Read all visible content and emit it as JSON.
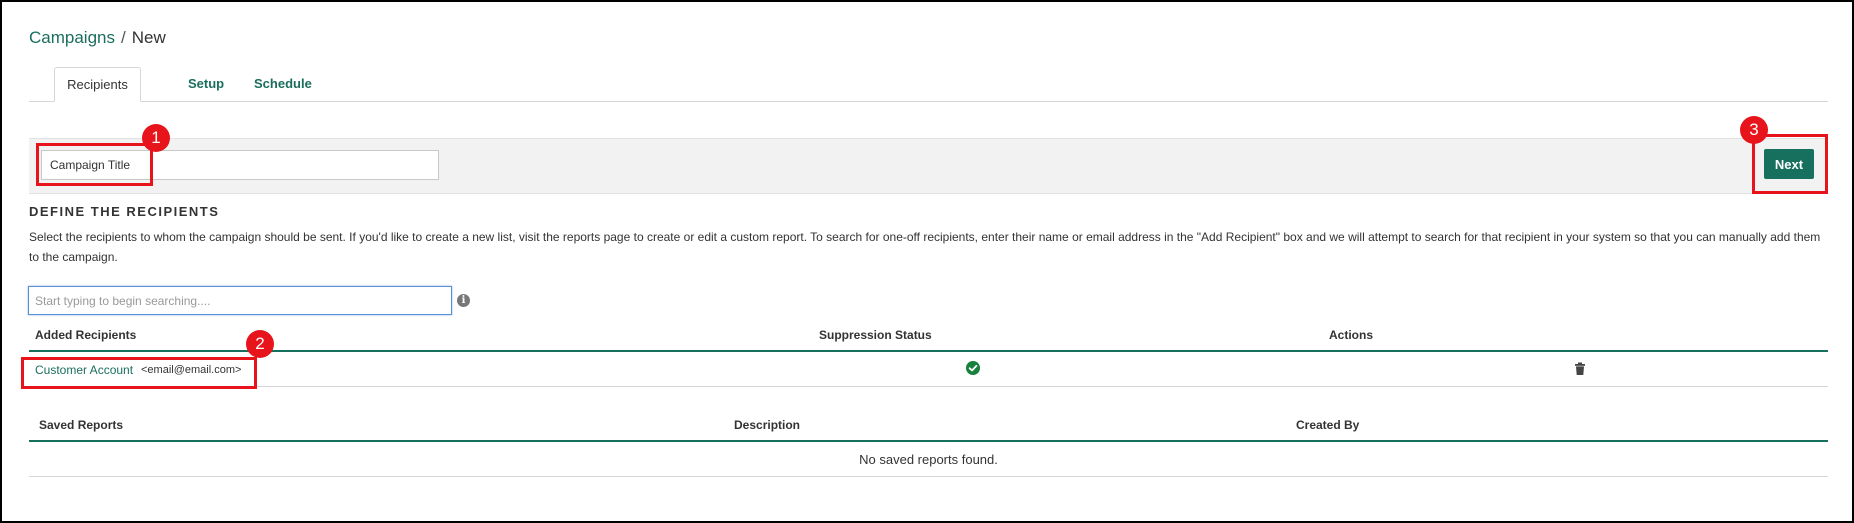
{
  "breadcrumb": {
    "parent": "Campaigns",
    "separator": "/",
    "current": "New"
  },
  "tabs": [
    {
      "label": "Recipients",
      "active": true
    },
    {
      "label": "Setup",
      "active": false
    },
    {
      "label": "Schedule",
      "active": false
    }
  ],
  "title_bar": {
    "title_value": "Campaign Title",
    "next_label": "Next"
  },
  "define": {
    "heading": "DEFINE THE RECIPIENTS",
    "description": "Select the recipients to whom the campaign should be sent. If you'd like to create a new list, visit the reports page to create or edit a custom report. To search for one-off recipients, enter their name or email address in the \"Add Recipient\" box and we will attempt to search for that recipient in your system so that you can manually add them to the campaign."
  },
  "search": {
    "placeholder": "Start typing to begin searching....",
    "info_icon": "i"
  },
  "recipients_table": {
    "headers": [
      "Added Recipients",
      "Suppression Status",
      "Actions"
    ],
    "rows": [
      {
        "name": "Customer Account",
        "email": "<email@email.com>",
        "suppression_icon": "check-circle-icon",
        "action_icon": "trash-icon"
      }
    ]
  },
  "reports_table": {
    "headers": [
      "Saved Reports",
      "Description",
      "Created By"
    ],
    "empty_message": "No saved reports found."
  },
  "callouts": [
    "1",
    "2",
    "3"
  ],
  "colors": {
    "brand_green": "#17705e",
    "link_green": "#1b6e5e",
    "callout_red": "#e8141b",
    "check_green": "#17803d"
  }
}
